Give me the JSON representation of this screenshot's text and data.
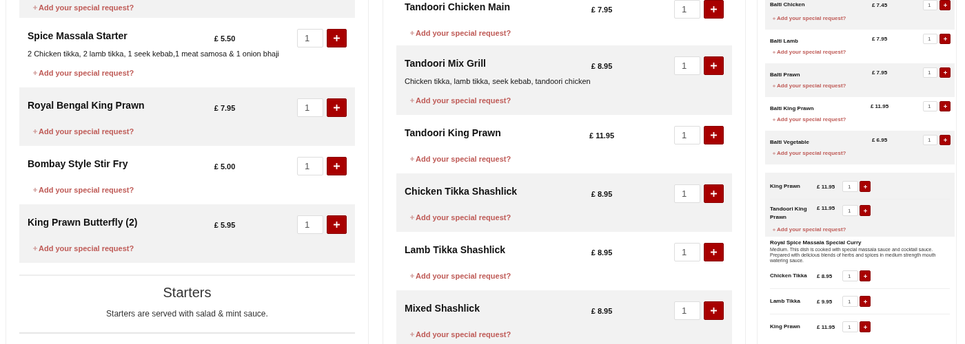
{
  "panels": [
    {
      "kind": "full",
      "blocks": [
        {
          "kind": "request",
          "shaded": true,
          "request": "Add your special request?"
        },
        {
          "kind": "dish",
          "shaded": false,
          "name": "Spice Massala Starter",
          "price": "£ 5.50",
          "description": "2 Chicken tikka, 2 lamb tikka, 1 seek kebab,1 meat samosa & 1 onion bhaji",
          "quantity": "1",
          "request": "Add your special request?"
        },
        {
          "kind": "dish",
          "shaded": true,
          "name": "Royal Bengal King Prawn",
          "price": "£ 7.95",
          "quantity": "1",
          "request": "Add your special request?"
        },
        {
          "kind": "dish",
          "shaded": false,
          "name": "Bombay Style Stir Fry",
          "price": "£ 5.00",
          "quantity": "1",
          "request": "Add your special request?"
        },
        {
          "kind": "dish",
          "shaded": true,
          "name": "King Prawn Butterfly (2)",
          "price": "£ 5.95",
          "quantity": "1",
          "request": "Add your special request?"
        },
        {
          "kind": "section",
          "title": "Starters",
          "note": "Starters are served with salad & mint sauce."
        }
      ]
    },
    {
      "kind": "full",
      "blocks": [
        {
          "kind": "dish",
          "shaded": false,
          "name": "Tandoori Chicken Main",
          "price": "£ 7.95",
          "quantity": "1",
          "request": "Add your special request?"
        },
        {
          "kind": "dish",
          "shaded": true,
          "name": "Tandoori Mix Grill",
          "price": "£ 8.95",
          "description": "Chicken tikka, lamb tikka, seek kebab, tandoori chicken",
          "quantity": "1",
          "request": "Add your special request?"
        },
        {
          "kind": "dish",
          "shaded": false,
          "name": "Tandoori King Prawn",
          "price": "£ 11.95",
          "quantity": "1",
          "request": "Add your special request?"
        },
        {
          "kind": "dish",
          "shaded": true,
          "name": "Chicken Tikka Shashlick",
          "price": "£ 8.95",
          "quantity": "1",
          "request": "Add your special request?"
        },
        {
          "kind": "dish",
          "shaded": false,
          "name": "Lamb Tikka Shashlick",
          "price": "£ 8.95",
          "quantity": "1",
          "request": "Add your special request?"
        },
        {
          "kind": "dish",
          "shaded": true,
          "name": "Mixed Shashlick",
          "price": "£ 8.95",
          "quantity": "1",
          "request": "Add your special request?"
        }
      ]
    },
    {
      "kind": "preview",
      "blocks": [
        {
          "kind": "dish",
          "shaded": true,
          "name": "Balti Chicken",
          "price": "£ 7.45",
          "quantity": "1",
          "request": "Add your special request?"
        },
        {
          "kind": "dish",
          "shaded": false,
          "name": "Balti Lamb",
          "price": "£ 7.95",
          "quantity": "1",
          "request": "Add your special request?"
        },
        {
          "kind": "dish",
          "shaded": true,
          "name": "Balti Prawn",
          "price": "£ 7.95",
          "quantity": "1",
          "request": "Add your special request?"
        },
        {
          "kind": "dish",
          "shaded": false,
          "name": "Balti King Prawn",
          "price": "£ 11.95",
          "quantity": "1",
          "request": "Add your special request?"
        },
        {
          "kind": "dish",
          "shaded": true,
          "name": "Balti Vegetable",
          "price": "£ 6.95",
          "quantity": "1",
          "request": "Add your special request?"
        },
        {
          "kind": "group",
          "shaded": true,
          "rows": [
            {
              "name": "King Prawn",
              "price": "£ 11.95",
              "quantity": "1"
            },
            {
              "name": "Tandoori King Prawn",
              "price": "£ 11.95",
              "quantity": "1"
            }
          ],
          "request": "Add your special request?"
        },
        {
          "kind": "category",
          "title": "Royal Spice Massala Special Curry",
          "description": "Medium. This dish is cooked with special massala sauce and cocktail sauce. Prepared with delicious blends of herbs and spices in medium strength mouth watering sauce."
        },
        {
          "kind": "group",
          "shaded": false,
          "rows": [
            {
              "name": "Chicken Tikka",
              "price": "£ 8.95",
              "quantity": "1"
            },
            {
              "name": "Lamb Tikka",
              "price": "£ 9.95",
              "quantity": "1"
            },
            {
              "name": "King Prawn",
              "price": "£ 11.95",
              "quantity": "1"
            }
          ]
        }
      ]
    }
  ]
}
